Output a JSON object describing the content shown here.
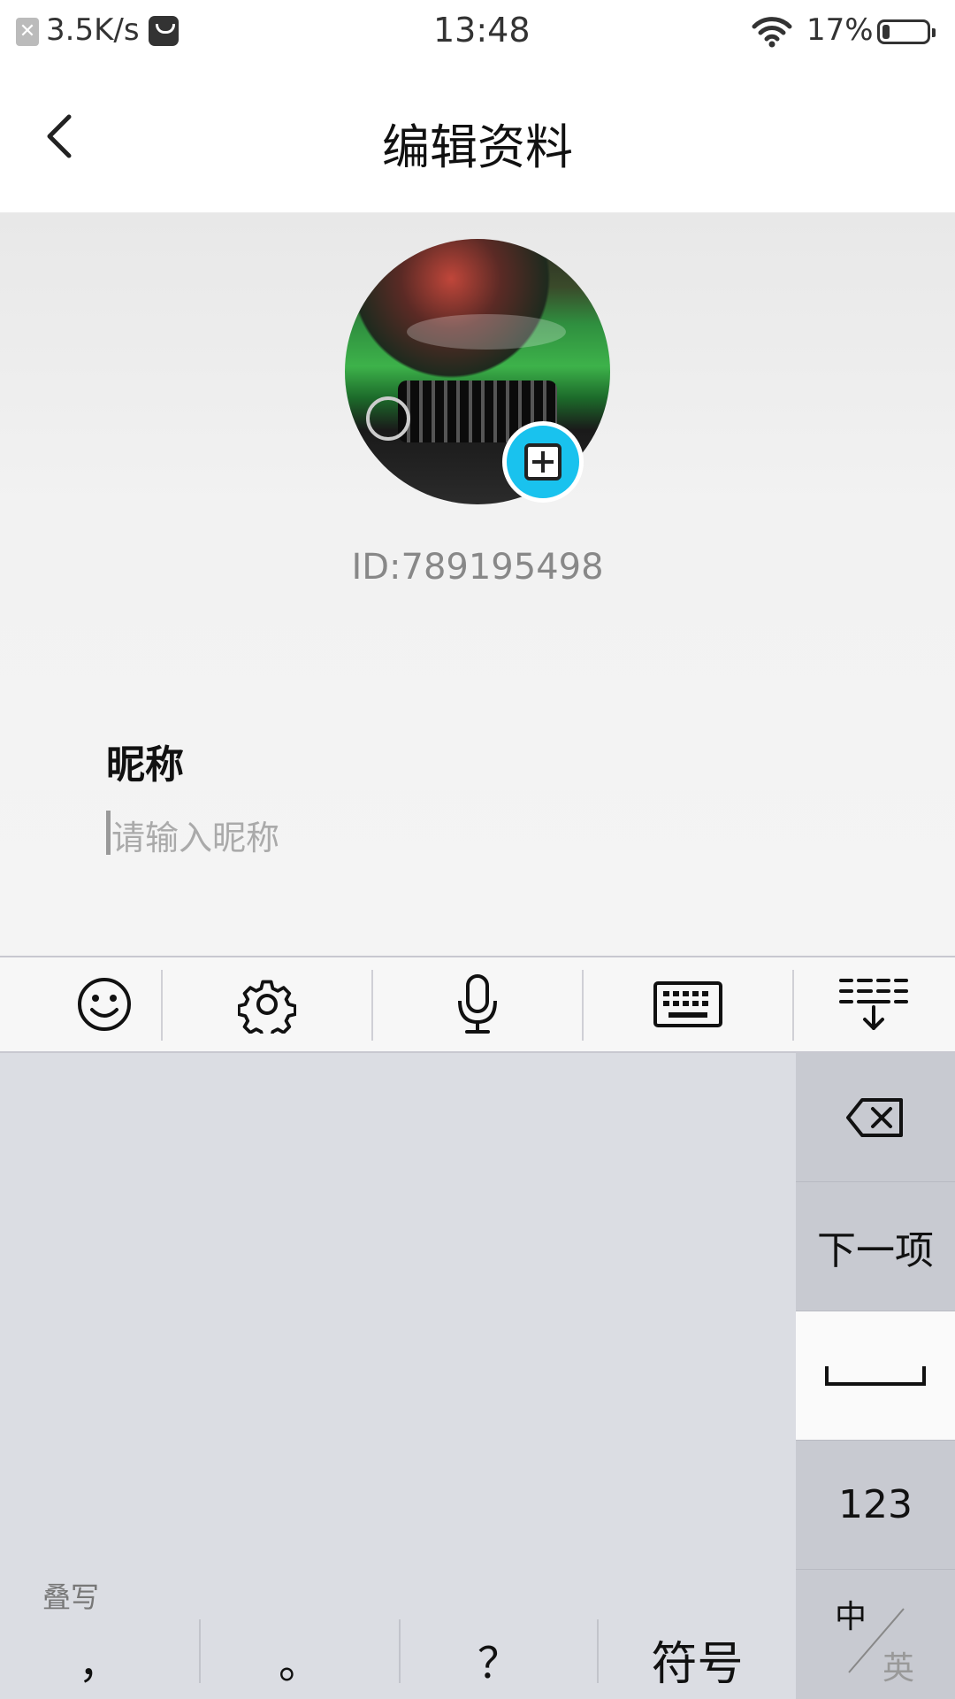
{
  "status_bar": {
    "net_speed": "3.5K/s",
    "time": "13:48",
    "battery": "17%",
    "battery_level": 0.17
  },
  "header": {
    "title": "编辑资料"
  },
  "profile": {
    "user_id": "ID:789195498"
  },
  "nickname": {
    "label": "昵称",
    "placeholder": "请输入昵称",
    "value": ""
  },
  "keyboard": {
    "toolbar_icons": [
      "emoji-icon",
      "settings-icon",
      "microphone-icon",
      "keyboard-icon",
      "collapse-keyboard-icon"
    ],
    "side_keys": {
      "next": "下一项",
      "numbers": "123",
      "lang_zh": "中",
      "lang_en": "英"
    },
    "stack_label": "叠写",
    "bottom_keys": {
      "comma": "，",
      "period": "。",
      "question": "？",
      "symbols": "符号"
    }
  },
  "colors": {
    "accent": "#19c2ee",
    "keyboard_bg": "#dbdde3",
    "side_key_bg": "#c8cad1"
  }
}
